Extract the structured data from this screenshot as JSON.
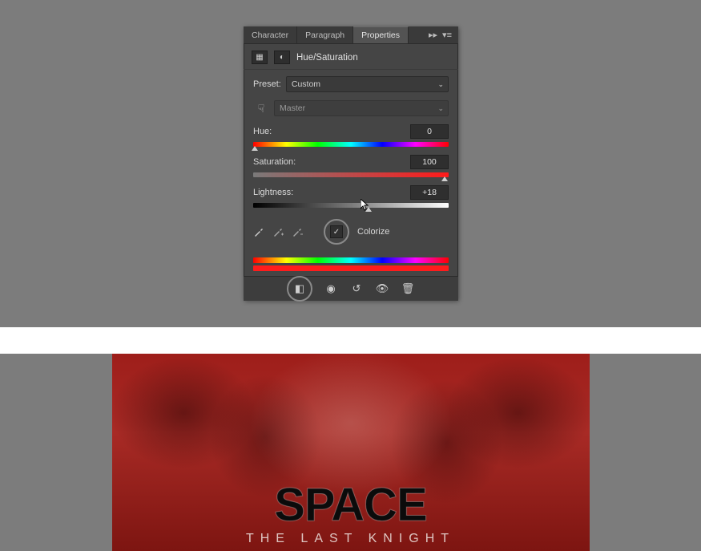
{
  "tabs": {
    "character": "Character",
    "paragraph": "Paragraph",
    "properties": "Properties"
  },
  "adjustment": {
    "title": "Hue/Saturation",
    "preset_label": "Preset:",
    "preset_value": "Custom",
    "channel_value": "Master",
    "hue_label": "Hue:",
    "sat_label": "Saturation:",
    "light_label": "Lightness:",
    "hue_value": "0",
    "sat_value": "100",
    "light_value": "+18",
    "colorize_label": "Colorize"
  },
  "poster": {
    "title": "SPACE",
    "subtitle": "THE LAST KNIGHT"
  }
}
